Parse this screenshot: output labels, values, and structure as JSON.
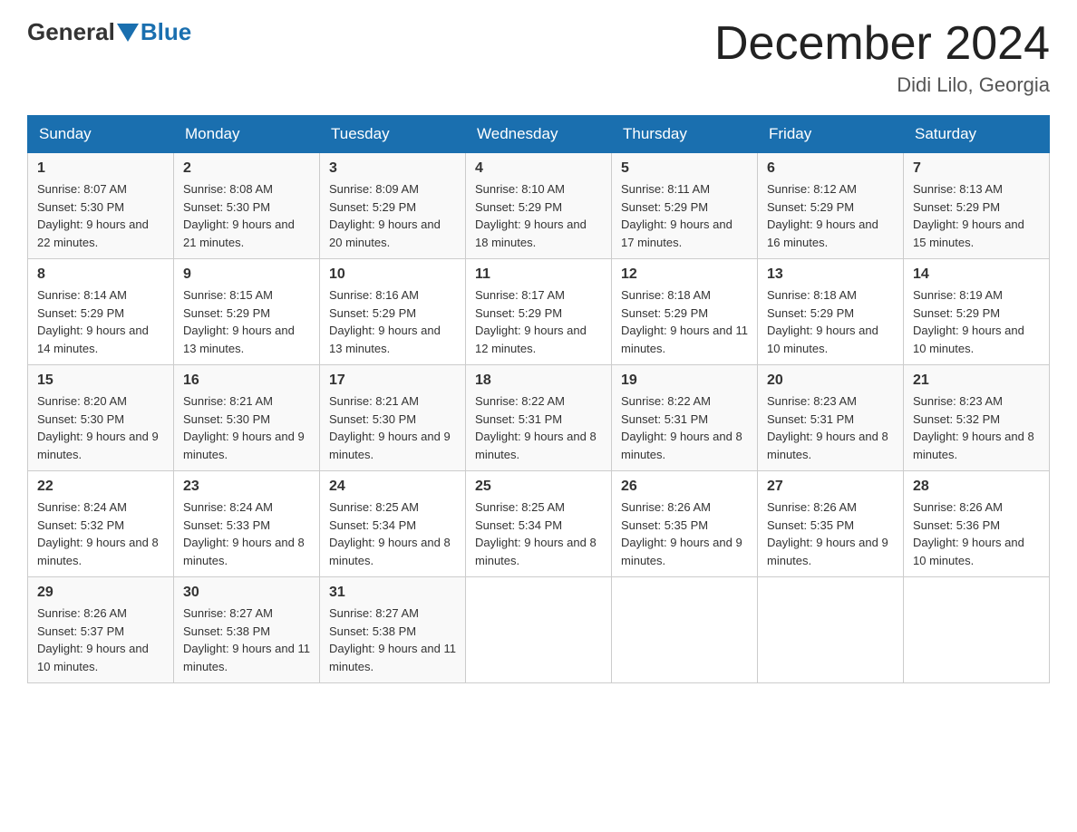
{
  "header": {
    "logo_general": "General",
    "logo_blue": "Blue",
    "month_title": "December 2024",
    "location": "Didi Lilo, Georgia"
  },
  "days_of_week": [
    "Sunday",
    "Monday",
    "Tuesday",
    "Wednesday",
    "Thursday",
    "Friday",
    "Saturday"
  ],
  "weeks": [
    [
      {
        "day": "1",
        "sunrise": "8:07 AM",
        "sunset": "5:30 PM",
        "daylight": "9 hours and 22 minutes."
      },
      {
        "day": "2",
        "sunrise": "8:08 AM",
        "sunset": "5:30 PM",
        "daylight": "9 hours and 21 minutes."
      },
      {
        "day": "3",
        "sunrise": "8:09 AM",
        "sunset": "5:29 PM",
        "daylight": "9 hours and 20 minutes."
      },
      {
        "day": "4",
        "sunrise": "8:10 AM",
        "sunset": "5:29 PM",
        "daylight": "9 hours and 18 minutes."
      },
      {
        "day": "5",
        "sunrise": "8:11 AM",
        "sunset": "5:29 PM",
        "daylight": "9 hours and 17 minutes."
      },
      {
        "day": "6",
        "sunrise": "8:12 AM",
        "sunset": "5:29 PM",
        "daylight": "9 hours and 16 minutes."
      },
      {
        "day": "7",
        "sunrise": "8:13 AM",
        "sunset": "5:29 PM",
        "daylight": "9 hours and 15 minutes."
      }
    ],
    [
      {
        "day": "8",
        "sunrise": "8:14 AM",
        "sunset": "5:29 PM",
        "daylight": "9 hours and 14 minutes."
      },
      {
        "day": "9",
        "sunrise": "8:15 AM",
        "sunset": "5:29 PM",
        "daylight": "9 hours and 13 minutes."
      },
      {
        "day": "10",
        "sunrise": "8:16 AM",
        "sunset": "5:29 PM",
        "daylight": "9 hours and 13 minutes."
      },
      {
        "day": "11",
        "sunrise": "8:17 AM",
        "sunset": "5:29 PM",
        "daylight": "9 hours and 12 minutes."
      },
      {
        "day": "12",
        "sunrise": "8:18 AM",
        "sunset": "5:29 PM",
        "daylight": "9 hours and 11 minutes."
      },
      {
        "day": "13",
        "sunrise": "8:18 AM",
        "sunset": "5:29 PM",
        "daylight": "9 hours and 10 minutes."
      },
      {
        "day": "14",
        "sunrise": "8:19 AM",
        "sunset": "5:29 PM",
        "daylight": "9 hours and 10 minutes."
      }
    ],
    [
      {
        "day": "15",
        "sunrise": "8:20 AM",
        "sunset": "5:30 PM",
        "daylight": "9 hours and 9 minutes."
      },
      {
        "day": "16",
        "sunrise": "8:21 AM",
        "sunset": "5:30 PM",
        "daylight": "9 hours and 9 minutes."
      },
      {
        "day": "17",
        "sunrise": "8:21 AM",
        "sunset": "5:30 PM",
        "daylight": "9 hours and 9 minutes."
      },
      {
        "day": "18",
        "sunrise": "8:22 AM",
        "sunset": "5:31 PM",
        "daylight": "9 hours and 8 minutes."
      },
      {
        "day": "19",
        "sunrise": "8:22 AM",
        "sunset": "5:31 PM",
        "daylight": "9 hours and 8 minutes."
      },
      {
        "day": "20",
        "sunrise": "8:23 AM",
        "sunset": "5:31 PM",
        "daylight": "9 hours and 8 minutes."
      },
      {
        "day": "21",
        "sunrise": "8:23 AM",
        "sunset": "5:32 PM",
        "daylight": "9 hours and 8 minutes."
      }
    ],
    [
      {
        "day": "22",
        "sunrise": "8:24 AM",
        "sunset": "5:32 PM",
        "daylight": "9 hours and 8 minutes."
      },
      {
        "day": "23",
        "sunrise": "8:24 AM",
        "sunset": "5:33 PM",
        "daylight": "9 hours and 8 minutes."
      },
      {
        "day": "24",
        "sunrise": "8:25 AM",
        "sunset": "5:34 PM",
        "daylight": "9 hours and 8 minutes."
      },
      {
        "day": "25",
        "sunrise": "8:25 AM",
        "sunset": "5:34 PM",
        "daylight": "9 hours and 8 minutes."
      },
      {
        "day": "26",
        "sunrise": "8:26 AM",
        "sunset": "5:35 PM",
        "daylight": "9 hours and 9 minutes."
      },
      {
        "day": "27",
        "sunrise": "8:26 AM",
        "sunset": "5:35 PM",
        "daylight": "9 hours and 9 minutes."
      },
      {
        "day": "28",
        "sunrise": "8:26 AM",
        "sunset": "5:36 PM",
        "daylight": "9 hours and 10 minutes."
      }
    ],
    [
      {
        "day": "29",
        "sunrise": "8:26 AM",
        "sunset": "5:37 PM",
        "daylight": "9 hours and 10 minutes."
      },
      {
        "day": "30",
        "sunrise": "8:27 AM",
        "sunset": "5:38 PM",
        "daylight": "9 hours and 11 minutes."
      },
      {
        "day": "31",
        "sunrise": "8:27 AM",
        "sunset": "5:38 PM",
        "daylight": "9 hours and 11 minutes."
      },
      null,
      null,
      null,
      null
    ]
  ]
}
